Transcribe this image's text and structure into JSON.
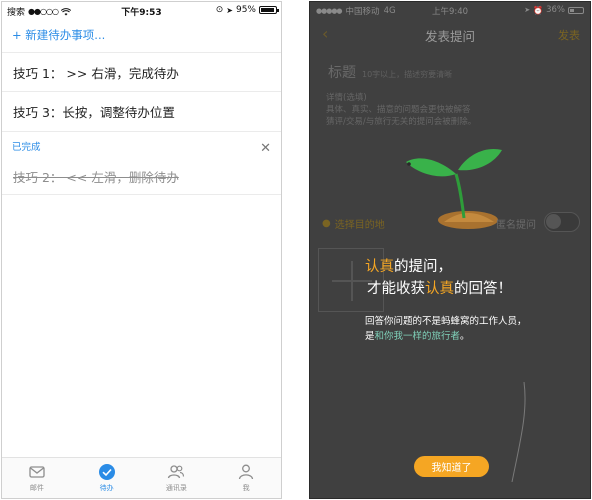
{
  "left": {
    "status": {
      "carrier": "搜索",
      "time": "下午9:53",
      "battery": "95%",
      "battery_level": 0.95
    },
    "new_todo": "+ 新建待办事项...",
    "items": [
      "技巧 1：  >> 右滑，完成待办",
      "技巧 3：长按，调整待办位置"
    ],
    "completed_label": "已完成",
    "completed_items": [
      "技巧 2：  << 左滑，删除待办"
    ],
    "tabs": [
      {
        "label": "邮件",
        "icon": "mail-icon"
      },
      {
        "label": "待办",
        "icon": "check-circle-icon",
        "active": true
      },
      {
        "label": "通讯录",
        "icon": "contacts-icon"
      },
      {
        "label": "我",
        "icon": "person-icon"
      }
    ],
    "colors": {
      "accent": "#2b8ce6"
    }
  },
  "right": {
    "status": {
      "carrier": "中国移动",
      "network": "4G",
      "time": "上午9:40",
      "battery": "36%",
      "battery_level": 0.36
    },
    "nav": {
      "back": "‹",
      "title": "发表提问",
      "publish": "发表"
    },
    "form": {
      "title_label": "标题",
      "title_hint": "10字以上，描述穷要清晰",
      "detail_label": "详情(选填)",
      "detail_hint_1": "具体、真实、描意的问题会更快被解答",
      "detail_hint_2": "猜评/交易/与旅行无关的提问会被删除。",
      "location": "选择目的地",
      "anonymous": "匿名提问"
    },
    "promo": {
      "line1_hl": "认真",
      "line1_rest": "的提问，",
      "line2_a": "才能收获",
      "line2_hl": "认真",
      "line2_b": "的回答！",
      "sub1": "回答你问题的不是蚂蜂窝的工作人员，",
      "sub2_a": "是",
      "sub2_hl": "和你我一样的旅行者",
      "sub2_b": "。"
    },
    "ok_button": "我知道了",
    "colors": {
      "highlight": "#f5a623",
      "teal": "#7fd1b9",
      "overlay": "#404040"
    }
  }
}
